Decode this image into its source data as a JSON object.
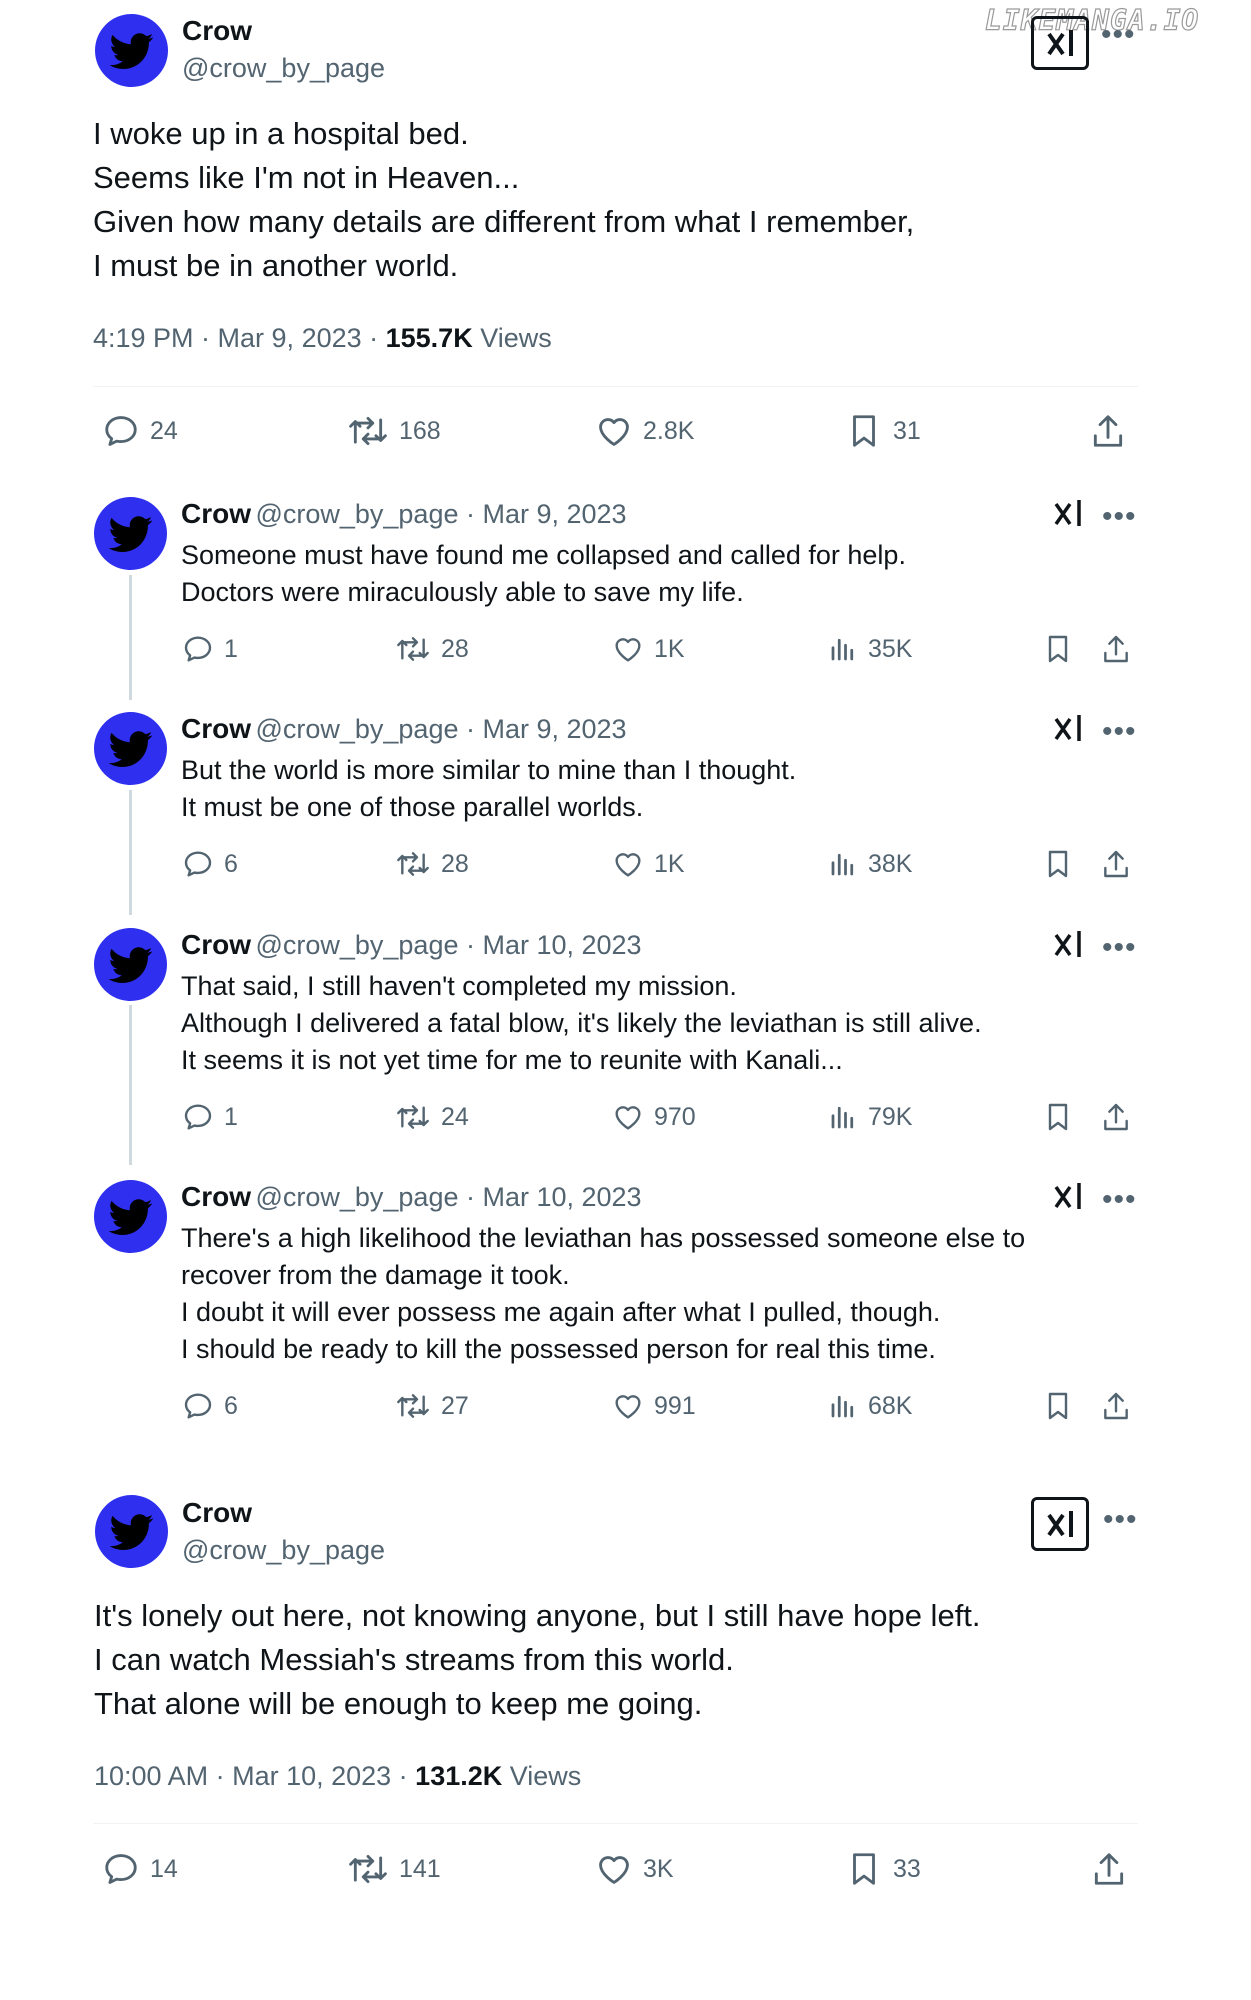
{
  "watermark": "LIKEMANGA.IO",
  "colors": {
    "avatar": "#2f2ff0",
    "text": "#0f1419",
    "muted": "#536471"
  },
  "tweet1": {
    "name": "Crow",
    "handle": "@crow_by_page",
    "lines": [
      "I woke up in a hospital bed.",
      "Seems like I'm not in Heaven...",
      "Given how many details are different from what I remember,",
      "I must be in another world."
    ],
    "time": "4:19 PM · Mar 9, 2023 · ",
    "views_count": "155.7K",
    "views_label": " Views",
    "replies": "24",
    "retweets": "168",
    "likes": "2.8K",
    "bookmarks": "31"
  },
  "replies": [
    {
      "name": "Crow",
      "meta": "@crow_by_page · Mar 9, 2023",
      "lines": [
        "Someone must have found me collapsed and called for help.",
        "Doctors were miraculously able to save my life."
      ],
      "replies": "1",
      "retweets": "28",
      "likes": "1K",
      "views": "35K"
    },
    {
      "name": "Crow",
      "meta": "@crow_by_page · Mar 9, 2023",
      "lines": [
        "But the world is more similar to mine than I thought.",
        "It must be one of those parallel worlds."
      ],
      "replies": "6",
      "retweets": "28",
      "likes": "1K",
      "views": "38K"
    },
    {
      "name": "Crow",
      "meta": "@crow_by_page · Mar 10, 2023",
      "lines": [
        "That said, I still haven't completed my mission.",
        "Although I delivered a fatal blow, it's likely the leviathan is still alive.",
        "It seems it is not yet time for me to reunite with Kanali..."
      ],
      "replies": "1",
      "retweets": "24",
      "likes": "970",
      "views": "79K"
    },
    {
      "name": "Crow",
      "meta": "@crow_by_page · Mar 10, 2023",
      "lines": [
        "There's a high likelihood the leviathan has possessed someone else to",
        "recover from the damage it took.",
        "I doubt it will ever possess me again after what I pulled, though.",
        "I should be ready to kill the possessed person for real this time."
      ],
      "replies": "6",
      "retweets": "27",
      "likes": "991",
      "views": "68K"
    }
  ],
  "tweet2": {
    "name": "Crow",
    "handle": "@crow_by_page",
    "lines": [
      "It's lonely out here, not knowing anyone, but I still have hope left.",
      "I can watch Messiah's streams from this world.",
      "That alone will be enough to keep me going."
    ],
    "time": "10:00 AM · Mar 10, 2023 · ",
    "views_count": "131.2K",
    "views_label": " Views",
    "replies": "14",
    "retweets": "141",
    "likes": "3K",
    "bookmarks": "33"
  },
  "icons": [
    "bird-icon",
    "grok-icon",
    "more-icon",
    "reply-icon",
    "retweet-icon",
    "like-icon",
    "bookmark-icon",
    "views-icon",
    "share-icon"
  ]
}
